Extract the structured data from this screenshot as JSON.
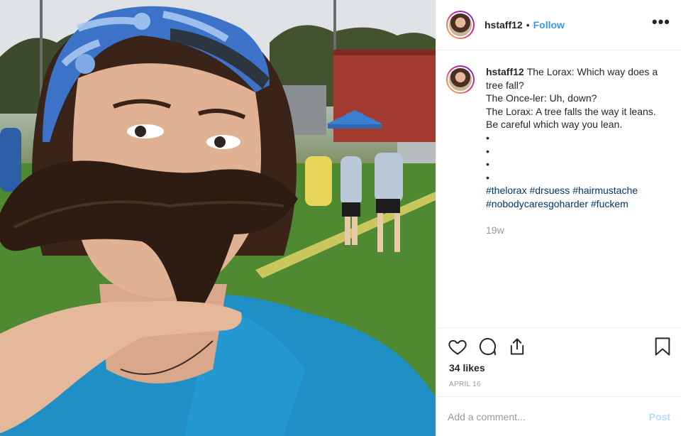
{
  "post": {
    "username": "hstaff12",
    "follow_label": "Follow",
    "more_icon": "more-options-icon",
    "separator": "•"
  },
  "caption": {
    "username": "hstaff12",
    "lines": [
      "The Lorax: Which way does a tree fall?",
      "The Once-ler: Uh, down?",
      "The Lorax: A tree falls the way it leans.",
      "Be careful which way you lean.",
      "•",
      "•",
      "•",
      "•"
    ],
    "hashtags_line1": [
      "#thelorax",
      "#drsuess",
      "#hairmustache"
    ],
    "hashtags_line2": [
      "#nobodycaresgoharder",
      "#fuckem"
    ],
    "time": "19w"
  },
  "actions": {
    "icons": [
      "heart-icon",
      "comment-icon",
      "share-icon",
      "bookmark-icon"
    ],
    "likes": "34 likes",
    "date": "APRIL 16"
  },
  "comment": {
    "placeholder": "Add a comment...",
    "post_label": "Post"
  },
  "colors": {
    "link": "#3897f0",
    "hashtag": "#003569",
    "muted": "#999999",
    "post_disabled": "#b3dbff"
  }
}
